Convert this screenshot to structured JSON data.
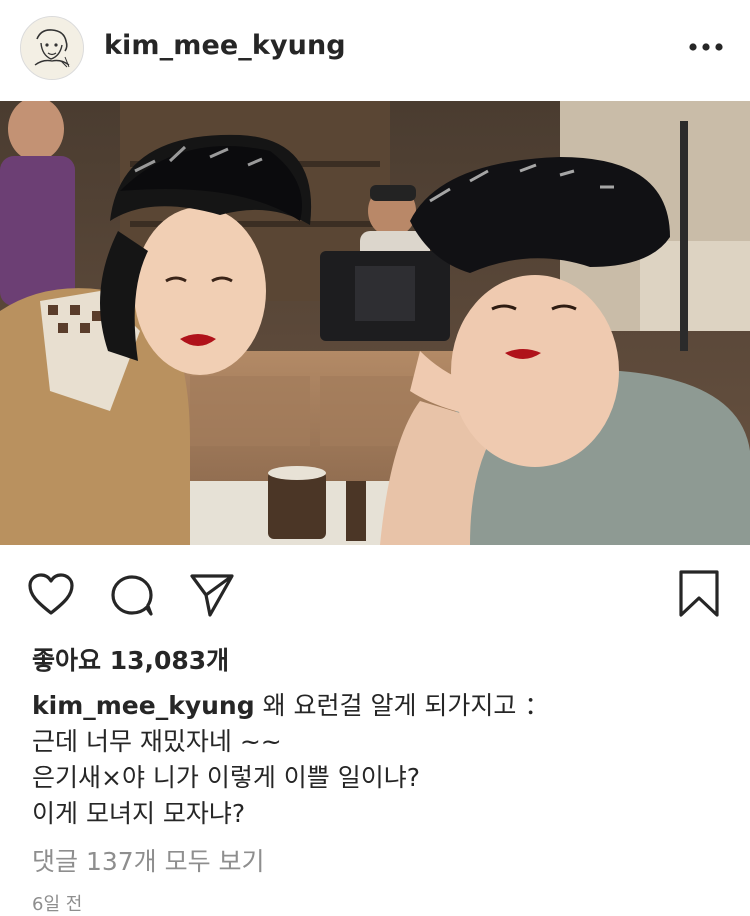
{
  "post": {
    "username": "kim_mee_kyung",
    "likes_text": "좋아요 13,083개",
    "caption_username": "kim_mee_kyung",
    "caption_lines": [
      "왜 요런걸 알게 되가지고 ：",
      "근데 너무 재밌자네 ~~",
      "은기새×야  니가 이렇게 이쁠 일이냐?",
      "이게 모녀지 모자냐?"
    ],
    "view_comments": "댓글 137개 모두 보기",
    "time_ago": "6일 전"
  },
  "icons": {
    "avatar": "avatar-illustration",
    "more": "more-icon",
    "like": "heart-icon",
    "comment": "comment-icon",
    "share": "send-icon",
    "save": "bookmark-icon"
  },
  "colors": {
    "text": "#262626",
    "muted": "#8e8e8e",
    "divider": "#dbdbdb"
  }
}
